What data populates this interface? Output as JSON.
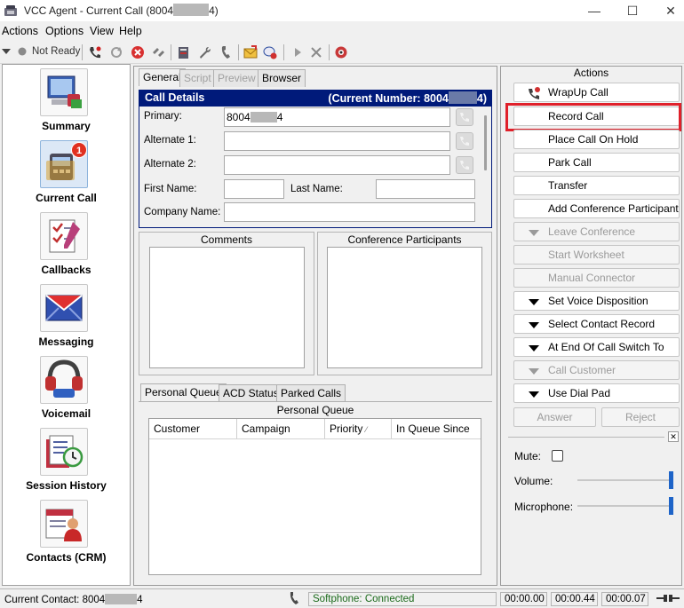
{
  "window": {
    "title_prefix": "VCC Agent - Current Call (8004",
    "title_suffix": "4)",
    "minimize_glyph": "—",
    "maximize_glyph": "☐",
    "close_glyph": "✕"
  },
  "menu": [
    "Actions",
    "Options",
    "View",
    "Help"
  ],
  "toolbar": {
    "status_label": "Not Ready",
    "icons": [
      "dropdown-arrow-icon",
      "status-dot-icon",
      "phone-icon",
      "refresh-icon",
      "stop-icon",
      "disconnect-icon",
      "notes-icon",
      "wrench-icon",
      "handset-icon",
      "email-icon",
      "chat-icon",
      "play-icon",
      "close-icon",
      "network-icon"
    ]
  },
  "nav": [
    {
      "label": "Summary",
      "icon": "summary-icon"
    },
    {
      "label": "Current Call",
      "icon": "current-call-icon",
      "badge": "1"
    },
    {
      "label": "Callbacks",
      "icon": "callbacks-icon"
    },
    {
      "label": "Messaging",
      "icon": "messaging-icon"
    },
    {
      "label": "Voicemail",
      "icon": "voicemail-icon"
    },
    {
      "label": "Session History",
      "icon": "session-history-icon"
    },
    {
      "label": "Contacts (CRM)",
      "icon": "contacts-icon"
    }
  ],
  "center_tabs": [
    {
      "label": "General",
      "state": "selected"
    },
    {
      "label": "Script",
      "state": "disabled"
    },
    {
      "label": "Preview",
      "state": "disabled"
    },
    {
      "label": "Browser",
      "state": "normal"
    }
  ],
  "call_details": {
    "title": "Call Details",
    "current_number_prefix": "(Current Number: 8004",
    "current_number_suffix": "4)",
    "primary_label": "Primary:",
    "primary_prefix": "8004",
    "primary_suffix": "4",
    "alternate1_label": "Alternate 1:",
    "alternate2_label": "Alternate 2:",
    "first_name_label": "First Name:",
    "last_name_label": "Last Name:",
    "company_label": "Company Name:"
  },
  "comments_title": "Comments",
  "conference_title": "Conference Participants",
  "queue_tabs": [
    {
      "label": "Personal Queue",
      "state": "selected"
    },
    {
      "label": "ACD Status",
      "state": "normal"
    },
    {
      "label": "Parked Calls",
      "state": "normal"
    }
  ],
  "queue": {
    "title": "Personal Queue",
    "columns": [
      "Customer",
      "Campaign",
      "Priority",
      "In Queue Since"
    ],
    "sort_indicator": "⁄"
  },
  "actions": {
    "title": "Actions",
    "buttons": [
      {
        "label": "WrapUp Call",
        "icon": "wrapup-icon",
        "enabled": true
      },
      {
        "label": "Record Call",
        "enabled": true
      },
      {
        "label": "Place Call On Hold",
        "enabled": true
      },
      {
        "label": "Park Call",
        "enabled": true
      },
      {
        "label": "Transfer",
        "enabled": true
      },
      {
        "label": "Add Conference Participant",
        "enabled": true
      },
      {
        "label": "Leave Conference",
        "dropdown": true,
        "enabled": false
      },
      {
        "label": "Start Worksheet",
        "enabled": false
      },
      {
        "label": "Manual Connector",
        "enabled": false
      },
      {
        "label": "Set Voice Disposition",
        "dropdown": true,
        "enabled": true
      },
      {
        "label": "Select Contact Record",
        "dropdown": true,
        "enabled": true
      },
      {
        "label": "At End Of Call Switch To",
        "dropdown": true,
        "enabled": true
      },
      {
        "label": "Call Customer",
        "dropdown": true,
        "enabled": false
      },
      {
        "label": "Use Dial Pad",
        "dropdown": true,
        "enabled": true
      }
    ],
    "answer_label": "Answer",
    "reject_label": "Reject"
  },
  "audio": {
    "mute_label": "Mute:",
    "mute_checked": false,
    "volume_label": "Volume:",
    "volume_level": 1.0,
    "microphone_label": "Microphone:",
    "microphone_level": 1.0,
    "close_glyph": "✕"
  },
  "status_bar": {
    "contact_prefix": "Current Contact: 8004",
    "contact_suffix": "4",
    "softphone": "Softphone: Connected",
    "timer1": "00:00.00",
    "timer2": "00:00.44",
    "timer3": "00:00.07"
  },
  "colors": {
    "header_bg": "#001a7a",
    "highlight": "#e0202a",
    "softphone_text": "#1a6a1a",
    "slider": "#1e64c8"
  }
}
